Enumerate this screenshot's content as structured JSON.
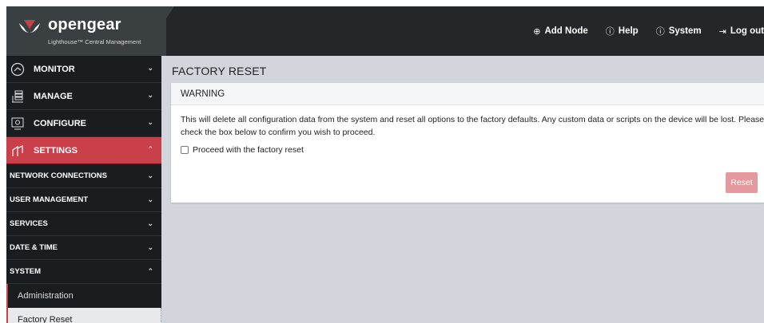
{
  "header": {
    "brand": "opengear",
    "brand_sub": "Lighthouse™ Central Management",
    "nav": [
      {
        "icon": "add-node-icon",
        "glyph": "⊕",
        "label": "Add Node"
      },
      {
        "icon": "help-icon",
        "glyph": "ⓘ",
        "label": "Help"
      },
      {
        "icon": "system-icon",
        "glyph": "ⓘ",
        "label": "System"
      },
      {
        "icon": "logout-icon",
        "glyph": "⇥",
        "label": "Log out"
      }
    ]
  },
  "sidebar": {
    "main": [
      {
        "label": "MONITOR",
        "icon": "monitor-icon",
        "expanded": false
      },
      {
        "label": "MANAGE",
        "icon": "manage-icon",
        "expanded": false
      },
      {
        "label": "CONFIGURE",
        "icon": "configure-icon",
        "expanded": false
      },
      {
        "label": "SETTINGS",
        "icon": "settings-icon",
        "expanded": true
      }
    ],
    "sub": [
      {
        "label": "NETWORK CONNECTIONS"
      },
      {
        "label": "USER MANAGEMENT"
      },
      {
        "label": "SERVICES"
      },
      {
        "label": "DATE & TIME"
      },
      {
        "label": "SYSTEM"
      }
    ],
    "leaves": [
      {
        "label": "Administration"
      },
      {
        "label": "Factory Reset"
      }
    ],
    "chevron_down": "⌄",
    "chevron_up": "⌃"
  },
  "main": {
    "title": "FACTORY RESET",
    "card": {
      "heading": "WARNING",
      "text": "This will delete all configuration data from the system and reset all options to the factory defaults. Any custom data or scripts on the device will be lost. Please check the box below to confirm you wish to proceed.",
      "checkbox_label": "Proceed with the factory reset",
      "checked": false,
      "reset_label": "Reset"
    }
  },
  "colors": {
    "accent": "#c9404a",
    "header_bg": "#232729",
    "sidebar_bg": "#1a1d1f",
    "content_bg": "#d2d5dc",
    "reset_button": "#e3999e"
  }
}
